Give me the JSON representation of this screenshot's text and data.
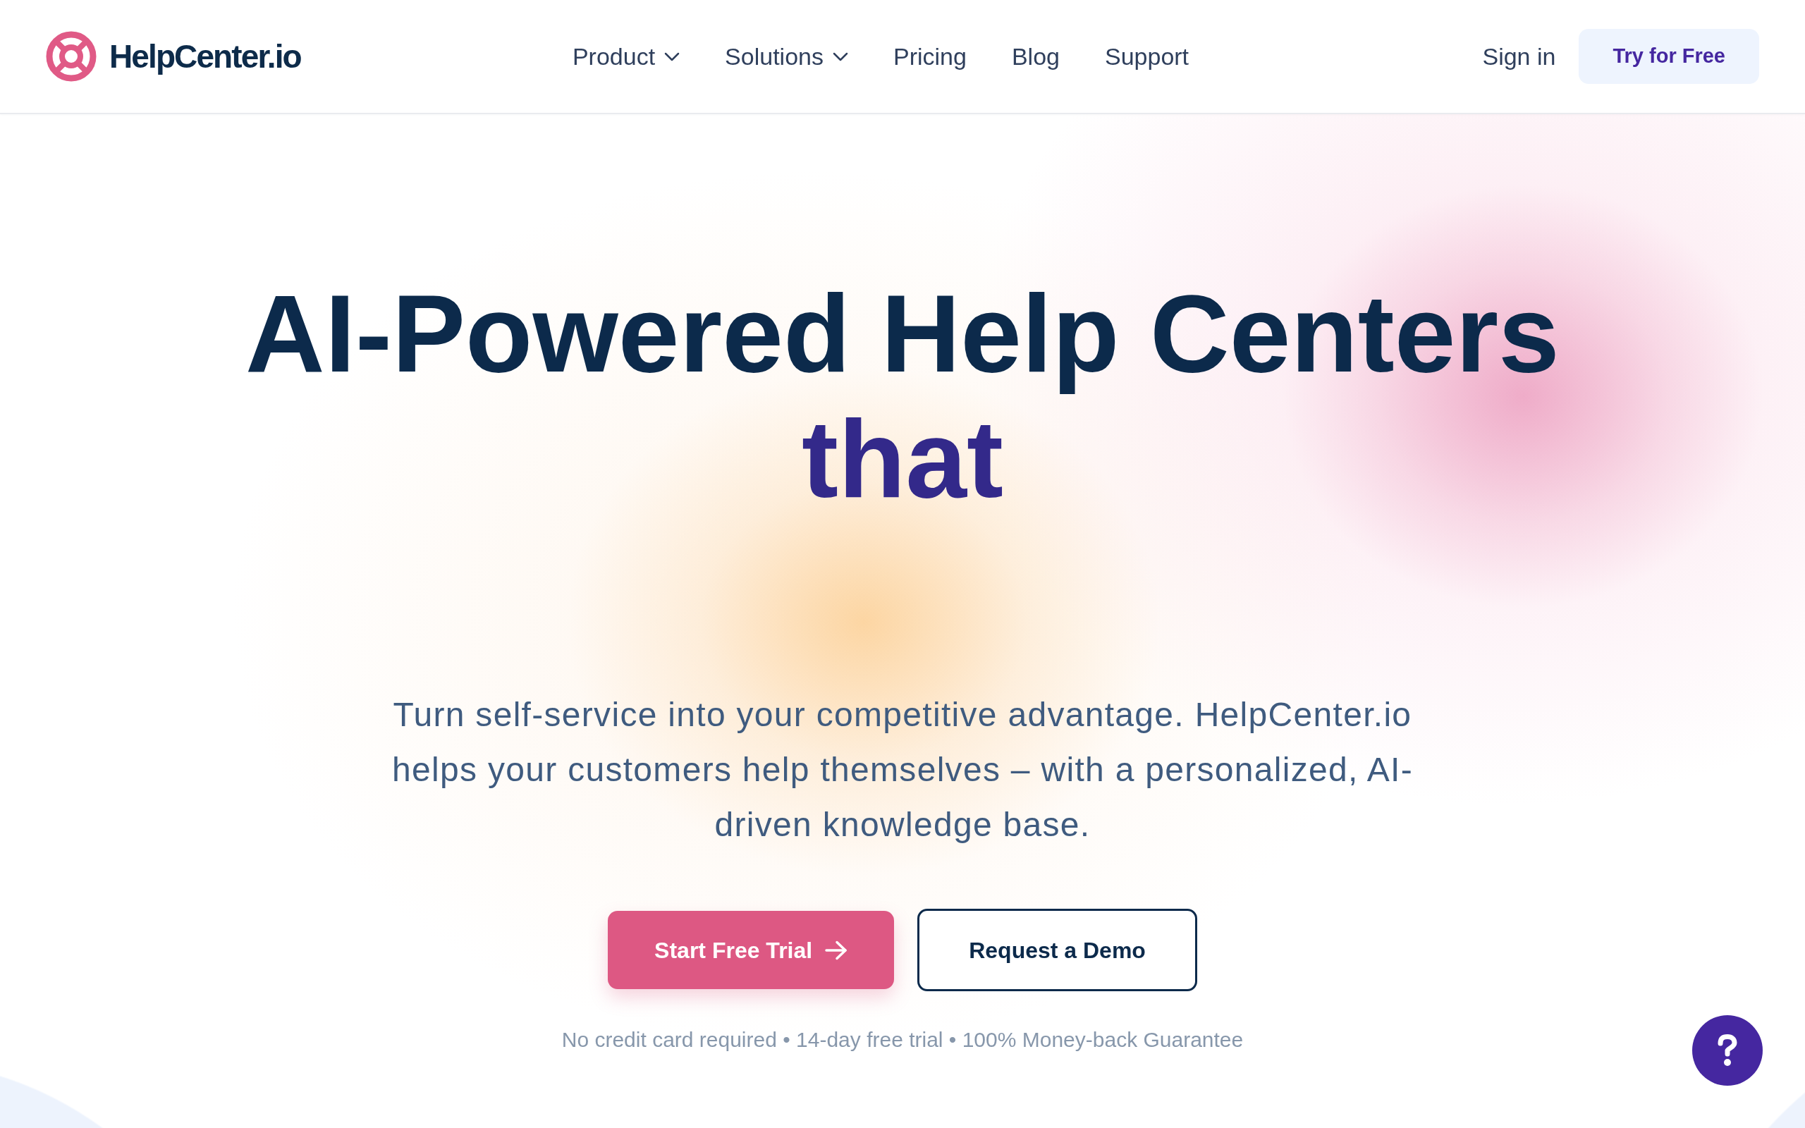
{
  "navbar": {
    "logo": "HelpCenter.io",
    "links": [
      {
        "label": "Product",
        "dropdown": true
      },
      {
        "label": "Solutions",
        "dropdown": true
      },
      {
        "label": "Pricing",
        "dropdown": false
      },
      {
        "label": "Blog",
        "dropdown": false
      },
      {
        "label": "Support",
        "dropdown": false
      }
    ],
    "sign_in": "Sign in",
    "cta_button": "Try for Free"
  },
  "hero": {
    "headline": "AI-Powered Help Centers",
    "headline_accent": "that",
    "subtitle": "Turn self-service into your competitive advantage. HelpCenter.io helps your customers help themselves – with a personalized, AI-driven knowledge base.",
    "primary_button": "Start Free Trial",
    "secondary_button": "Request a Demo",
    "fine_print": "No credit card required • 14-day free trial • 100% Money-back Guarantee"
  }
}
